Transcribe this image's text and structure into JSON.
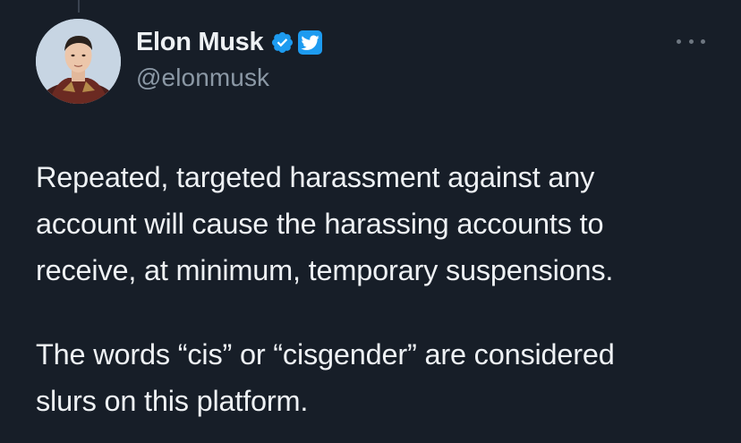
{
  "author": {
    "display_name": "Elon Musk",
    "handle": "@elonmusk",
    "verified": true
  },
  "icons": {
    "verified": "verified-check-icon",
    "bird": "twitter-bird-icon",
    "more": "more-horizontal-icon"
  },
  "colors": {
    "background": "#171e28",
    "text": "#eef1f4",
    "secondary_text": "#8b98a5",
    "verified_blue": "#1d9bf0"
  },
  "tweet": {
    "paragraphs": [
      {
        "lines": [
          "Repeated, targeted harassment against any",
          "account will cause the harassing accounts to",
          "receive, at minimum, temporary suspensions."
        ]
      },
      {
        "lines": [
          "The words “cis” or “cisgender” are considered",
          "slurs on this platform."
        ]
      }
    ]
  }
}
